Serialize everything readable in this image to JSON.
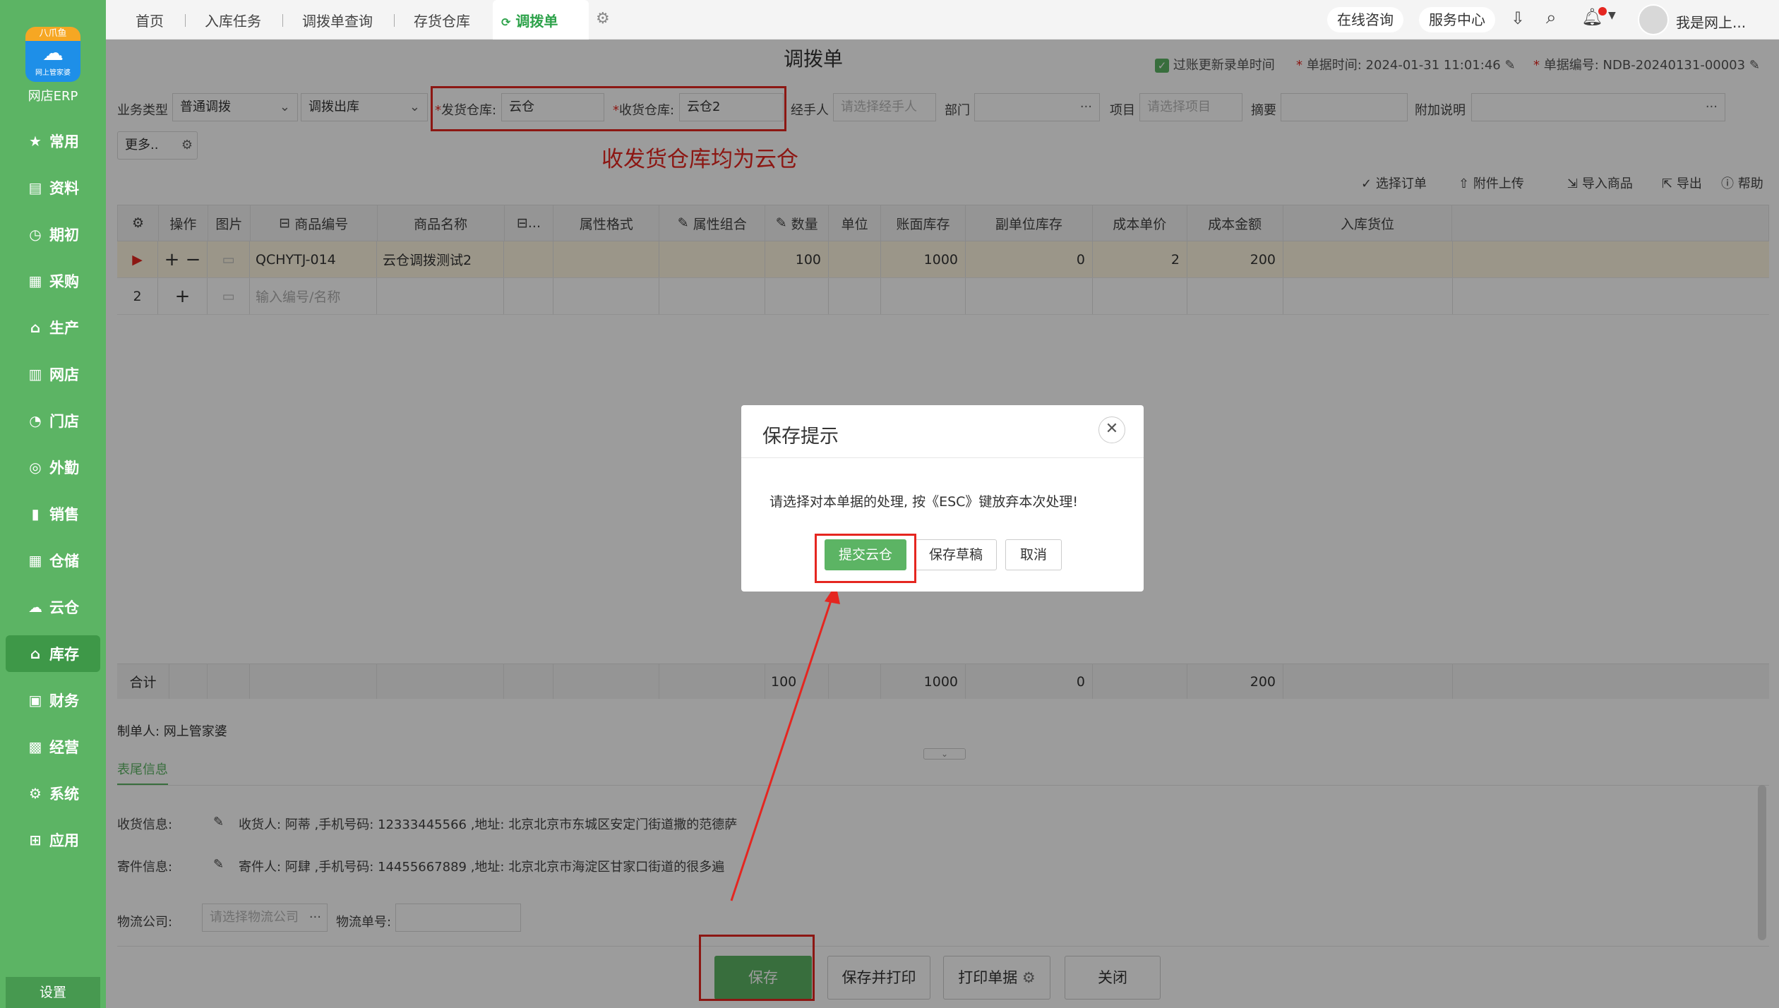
{
  "app": {
    "logo_badge": "八爪鱼",
    "logo_sub": "网上管家婆",
    "name": "网店ERP",
    "settings": "设置"
  },
  "nav": [
    "常用",
    "资料",
    "期初",
    "采购",
    "生产",
    "网店",
    "门店",
    "外勤",
    "销售",
    "仓储",
    "云仓",
    "库存",
    "财务",
    "经营",
    "系统",
    "应用"
  ],
  "nav_icons": [
    "star-icon",
    "doc-icon",
    "clock-icon",
    "cart-icon",
    "factory-icon",
    "store-icon",
    "pie-icon",
    "target-icon",
    "chart-icon",
    "warehouse-icon",
    "cloud-warehouse-icon",
    "home-icon",
    "wallet-icon",
    "briefcase-icon",
    "gear-icon",
    "plus-box-icon"
  ],
  "tabs": [
    "首页",
    "入库任务",
    "调拨单查询",
    "存货仓库",
    "调拨单"
  ],
  "topbar": {
    "consult": "在线咨询",
    "service": "服务中心",
    "user": "我是网上..."
  },
  "page": {
    "title": "调拨单",
    "sync_check": "过账更新录单时间",
    "time_label": "单据时间:",
    "time_value": "2024-01-31 11:01:46",
    "no_label": "单据编号:",
    "no_value": "NDB-20240131-00003"
  },
  "form": {
    "biz_type_label": "业务类型",
    "biz_type": "普通调拨",
    "out_type": "调拨出库",
    "from_label": "发货仓库:",
    "from_value": "云仓",
    "to_label": "收货仓库:",
    "to_value": "云仓2",
    "handler_label": "经手人",
    "handler_ph": "请选择经手人",
    "dept_label": "部门",
    "project_label": "项目",
    "project_ph": "请选择项目",
    "summary_label": "摘要",
    "extra_label": "附加说明",
    "more": "更多.."
  },
  "annotation": "收发货仓库均为云仓",
  "toolbar": {
    "select_order": "选择订单",
    "attach": "附件上传",
    "import": "导入商品",
    "export": "导出",
    "help": "帮助"
  },
  "grid": {
    "headers": [
      "操作",
      "图片",
      "商品编号",
      "商品名称",
      "...",
      "属性格式",
      "属性组合",
      "数量",
      "单位",
      "账面库存",
      "副单位库存",
      "成本单价",
      "成本金额",
      "入库货位"
    ],
    "row1": {
      "code": "QCHYTJ-014",
      "name": "云仓调拨测试2",
      "qty": "100",
      "stock": "1000",
      "sub_stock": "0",
      "price": "2",
      "amount": "200"
    },
    "row2": {
      "no": "2",
      "placeholder": "输入编号/名称"
    },
    "total": {
      "label": "合计",
      "qty": "100",
      "stock": "1000",
      "sub_stock": "0",
      "amount": "200"
    }
  },
  "footer": {
    "maker": "制单人: 网上管家婆",
    "tab": "表尾信息",
    "recv_label": "收货信息:",
    "recv": "收货人: 阿蒂 ,手机号码: 12333445566 ,地址: 北京北京市东城区安定门街道撒的范德萨",
    "send_label": "寄件信息:",
    "send": "寄件人: 阿肆 ,手机号码: 14455667889 ,地址: 北京北京市海淀区甘家口街道的很多遍",
    "logistics_label": "物流公司:",
    "logistics_ph": "请选择物流公司",
    "tracking_label": "物流单号:"
  },
  "buttons": {
    "save": "保存",
    "save_print": "保存并打印",
    "print": "打印单据",
    "close": "关闭"
  },
  "dialog": {
    "title": "保存提示",
    "message": "请选择对本单据的处理, 按《ESC》键放弃本次处理!",
    "submit": "提交云仓",
    "draft": "保存草稿",
    "cancel": "取消"
  },
  "colors": {
    "brand": "#5cb464",
    "annotation": "#e52620"
  }
}
